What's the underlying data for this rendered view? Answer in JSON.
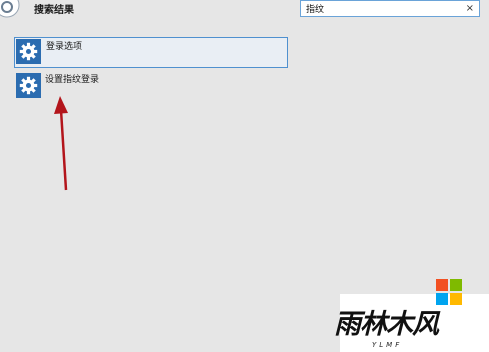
{
  "header": {
    "title": "搜索结果",
    "icon": "gear-icon"
  },
  "search": {
    "value": "指纹",
    "clear_label": "×"
  },
  "results": [
    {
      "label": "登录选项",
      "icon": "gear-icon",
      "selected": true
    },
    {
      "label": "设置指纹登录",
      "icon": "gear-icon",
      "selected": false
    }
  ],
  "colors": {
    "background": "#e6e6e6",
    "tile_blue": "#2b6cb0",
    "selection_border": "#4f90cf",
    "annotation_arrow": "#b3151b"
  },
  "watermark": {
    "text": "雨林木风",
    "sub": "YLMF",
    "logo": "windows-logo",
    "logo_colors": [
      "#f25022",
      "#7fba00",
      "#00a4ef",
      "#ffb900"
    ]
  }
}
